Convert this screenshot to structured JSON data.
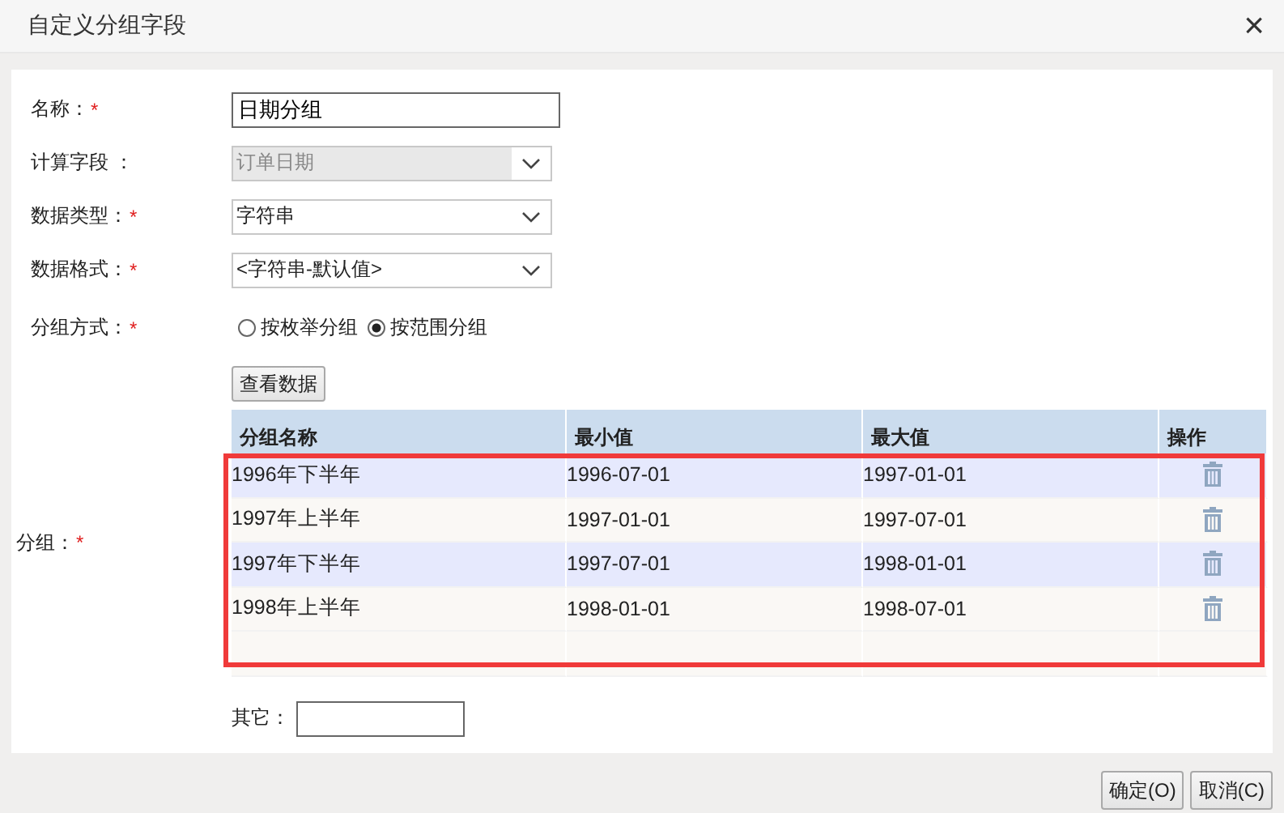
{
  "window": {
    "title": "自定义分组字段",
    "close": "×"
  },
  "fields": [
    {
      "kind": "input",
      "label": "名称：",
      "required_mark": "*",
      "value": "日期分组"
    },
    {
      "kind": "select",
      "label": "计算字段 ：",
      "value": "订单日期",
      "disabled": true
    },
    {
      "kind": "select",
      "label": "数据类型：",
      "required_mark": "*",
      "value": "字符串",
      "disabled": false
    },
    {
      "kind": "select",
      "label": "数据格式：",
      "required_mark": "*",
      "value": "<字符串-默认值>",
      "disabled": false
    }
  ],
  "grouping_mode": {
    "label": "分组方式：",
    "required_mark": "*",
    "options": [
      {
        "label": "按枚举分组",
        "selected": false
      },
      {
        "label": "按范围分组",
        "selected": true
      }
    ]
  },
  "view_data_button": "查看数据",
  "groups": {
    "label": "分组：",
    "required_mark": "*",
    "highlighted": true,
    "columns": [
      "分组名称",
      "最小值",
      "最大值",
      "操作"
    ],
    "rows": [
      {
        "name": "1996年下半年",
        "min": "1996-07-01",
        "max": "1997-01-01"
      },
      {
        "name": "1997年上半年",
        "min": "1997-01-01",
        "max": "1997-07-01"
      },
      {
        "name": "1997年下半年",
        "min": "1997-07-01",
        "max": "1998-01-01"
      },
      {
        "name": "1998年上半年",
        "min": "1998-01-01",
        "max": "1998-07-01"
      }
    ]
  },
  "other": {
    "label": "其它："
  },
  "buttons": [
    "确定(O)",
    "取消(C)"
  ]
}
